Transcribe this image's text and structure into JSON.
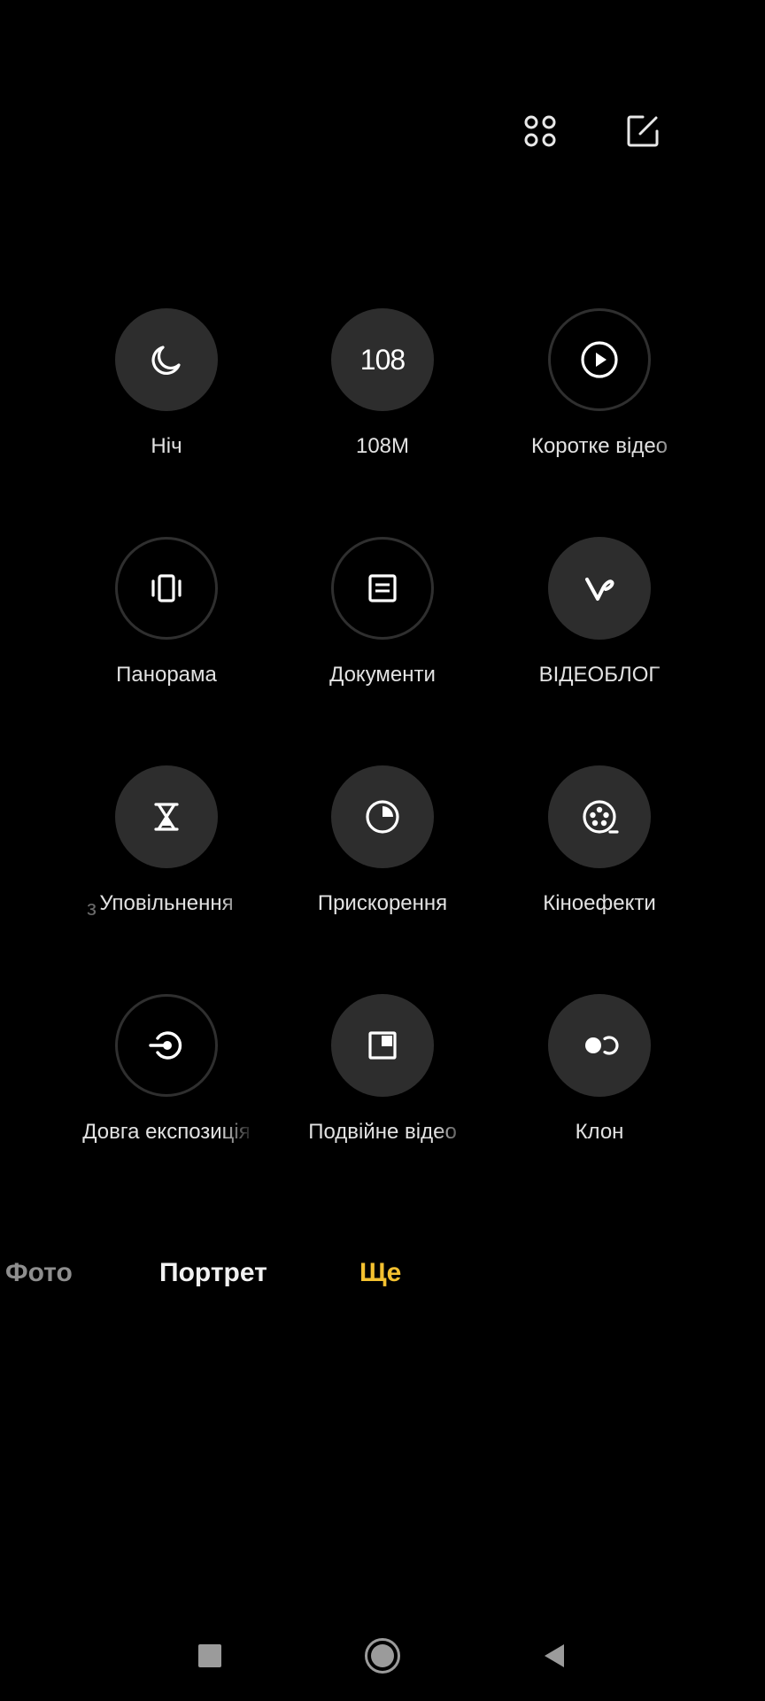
{
  "toolbar": {
    "grid_icon": "grid-4-dots-icon",
    "edit_icon": "edit-square-icon"
  },
  "modes": [
    {
      "label": "Ніч",
      "icon": "moon-icon"
    },
    {
      "label": "108M",
      "badge": "108"
    },
    {
      "label": "Коротке відео",
      "icon": "play-circle-icon"
    },
    {
      "label": "Панорама",
      "icon": "panorama-icon"
    },
    {
      "label": "Документи",
      "icon": "document-icon"
    },
    {
      "label": "ВІДЕОБЛОГ",
      "icon": "vlog-v-icon"
    },
    {
      "label": "Уповільнення",
      "icon": "hourglass-icon"
    },
    {
      "label": "Прискорення",
      "icon": "timelapse-icon"
    },
    {
      "label": "Кіноефекти",
      "icon": "film-reel-icon"
    },
    {
      "label": "Довга експозиція",
      "icon": "long-exposure-icon"
    },
    {
      "label": "Подвійне відео",
      "icon": "dual-video-icon"
    },
    {
      "label": "Клон",
      "icon": "clone-icon"
    }
  ],
  "ghost_label": "з",
  "tabs": {
    "photo": "Фото",
    "portrait": "Портрет",
    "more": "Ще"
  },
  "colors": {
    "accent": "#f4c130",
    "button_bg": "#2d2d2d",
    "background": "#000000"
  },
  "nav": {
    "recents_icon": "square-icon",
    "home_icon": "circle-home-icon",
    "back_icon": "triangle-back-icon"
  }
}
